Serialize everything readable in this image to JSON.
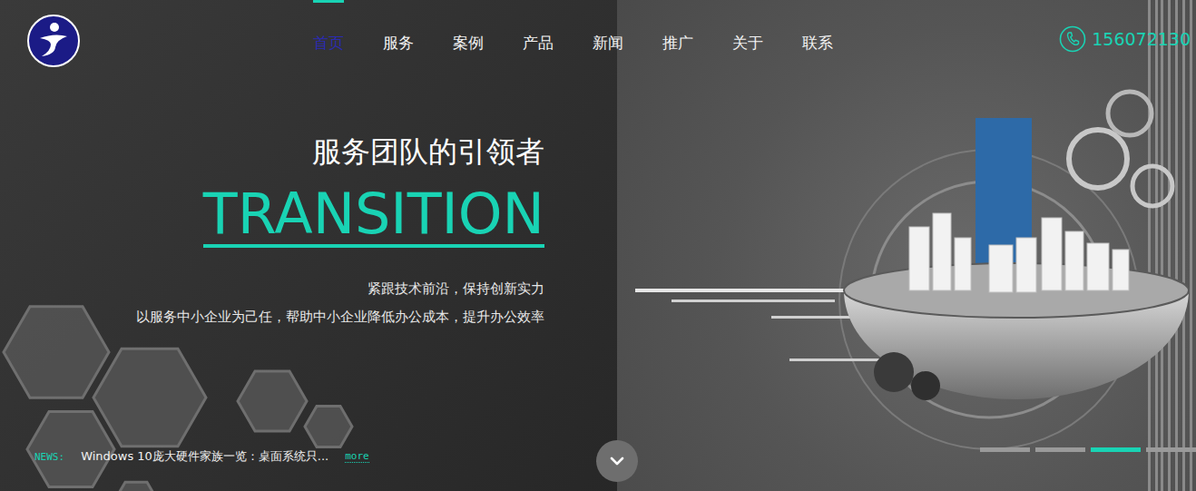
{
  "nav": {
    "items": [
      {
        "label": "首页",
        "selected": true
      },
      {
        "label": "服务",
        "selected": false
      },
      {
        "label": "案例",
        "selected": false
      },
      {
        "label": "产品",
        "selected": false
      },
      {
        "label": "新闻",
        "selected": false
      },
      {
        "label": "推广",
        "selected": false
      },
      {
        "label": "关于",
        "selected": false
      },
      {
        "label": "联系",
        "selected": false
      }
    ]
  },
  "phone": "156072130",
  "hero": {
    "subtitle": "服务团队的引领者",
    "title": "TRANSITION",
    "lines": [
      "紧跟技术前沿，保持创新实力",
      "以服务中小企业为己任，帮助中小企业降低办公成本，提升办公效率"
    ]
  },
  "news": {
    "label": "NEWS:",
    "headline": "Windows 10庞大硬件家族一览：桌面系统只...",
    "more": "more"
  },
  "slides": [
    {
      "selected": false
    },
    {
      "selected": false
    },
    {
      "selected": true
    },
    {
      "selected": false
    }
  ]
}
